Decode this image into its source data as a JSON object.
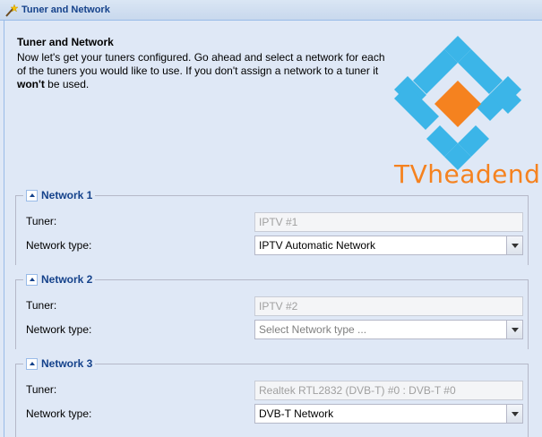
{
  "window": {
    "title": "Tuner and Network"
  },
  "intro": {
    "heading": "Tuner and Network",
    "text_part1": "Now let's get your tuners configured. Go ahead and select a network for each of the tuners you would like to use. If you don't assign a network to a tuner it ",
    "text_bold": "won't",
    "text_part2": " be used."
  },
  "logo": {
    "text": "TVheadend",
    "colors": {
      "blue": "#3bb5e8",
      "orange": "#f5821f"
    }
  },
  "networks": [
    {
      "legend": "Network 1",
      "tuner_label": "Tuner:",
      "tuner_value": "IPTV #1",
      "type_label": "Network type:",
      "type_value": "IPTV Automatic Network"
    },
    {
      "legend": "Network 2",
      "tuner_label": "Tuner:",
      "tuner_value": "IPTV #2",
      "type_label": "Network type:",
      "type_value": "Select Network type ..."
    },
    {
      "legend": "Network 3",
      "tuner_label": "Tuner:",
      "tuner_value": "Realtek RTL2832 (DVB-T) #0 : DVB-T #0",
      "type_label": "Network type:",
      "type_value": "DVB-T Network"
    }
  ]
}
